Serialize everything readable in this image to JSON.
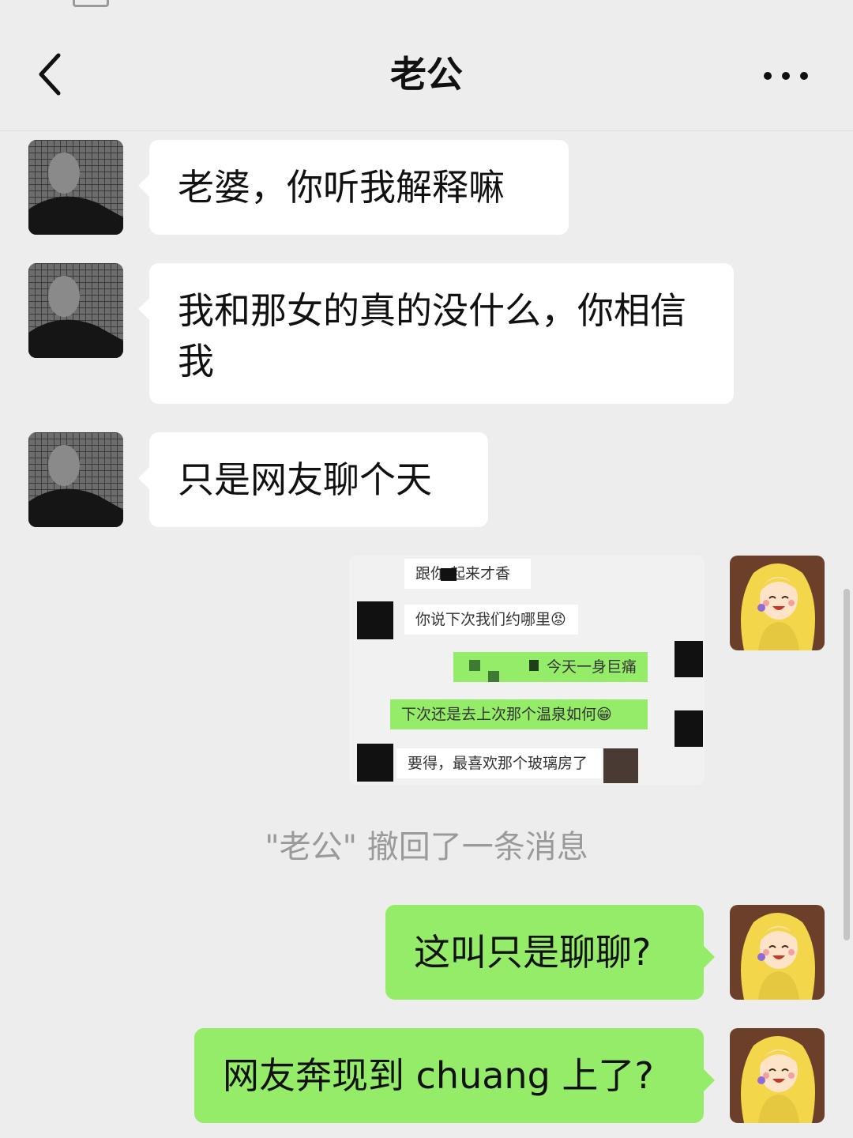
{
  "header": {
    "title": "老公"
  },
  "messages": [
    {
      "from": "husband",
      "text": "老婆，你听我解释嘛"
    },
    {
      "from": "husband",
      "text": "我和那女的真的没什么，你相信我"
    },
    {
      "from": "husband",
      "text": "只是网友聊个天"
    },
    {
      "from": "me",
      "type": "image",
      "rows": [
        {
          "side": "left",
          "text": "跟你 起来才香"
        },
        {
          "side": "left",
          "text": "你说下次我们约哪里😡"
        },
        {
          "side": "right",
          "text": "今天一身巨痛"
        },
        {
          "side": "right",
          "text": "下次还是去上次那个温泉如何😁"
        },
        {
          "side": "left",
          "text": "要得，最喜欢那个玻璃房了"
        }
      ]
    },
    {
      "from": "me",
      "text": "这叫只是聊聊?"
    },
    {
      "from": "me",
      "text": "网友奔现到 chuang 上了?"
    }
  ],
  "system_notice": "\"老公\" 撤回了一条消息",
  "colors": {
    "background": "#ededed",
    "incoming_bubble": "#ffffff",
    "outgoing_bubble": "#95ec69"
  },
  "icons": {
    "back": "chevron-left-icon",
    "more": "more-dots-icon"
  }
}
